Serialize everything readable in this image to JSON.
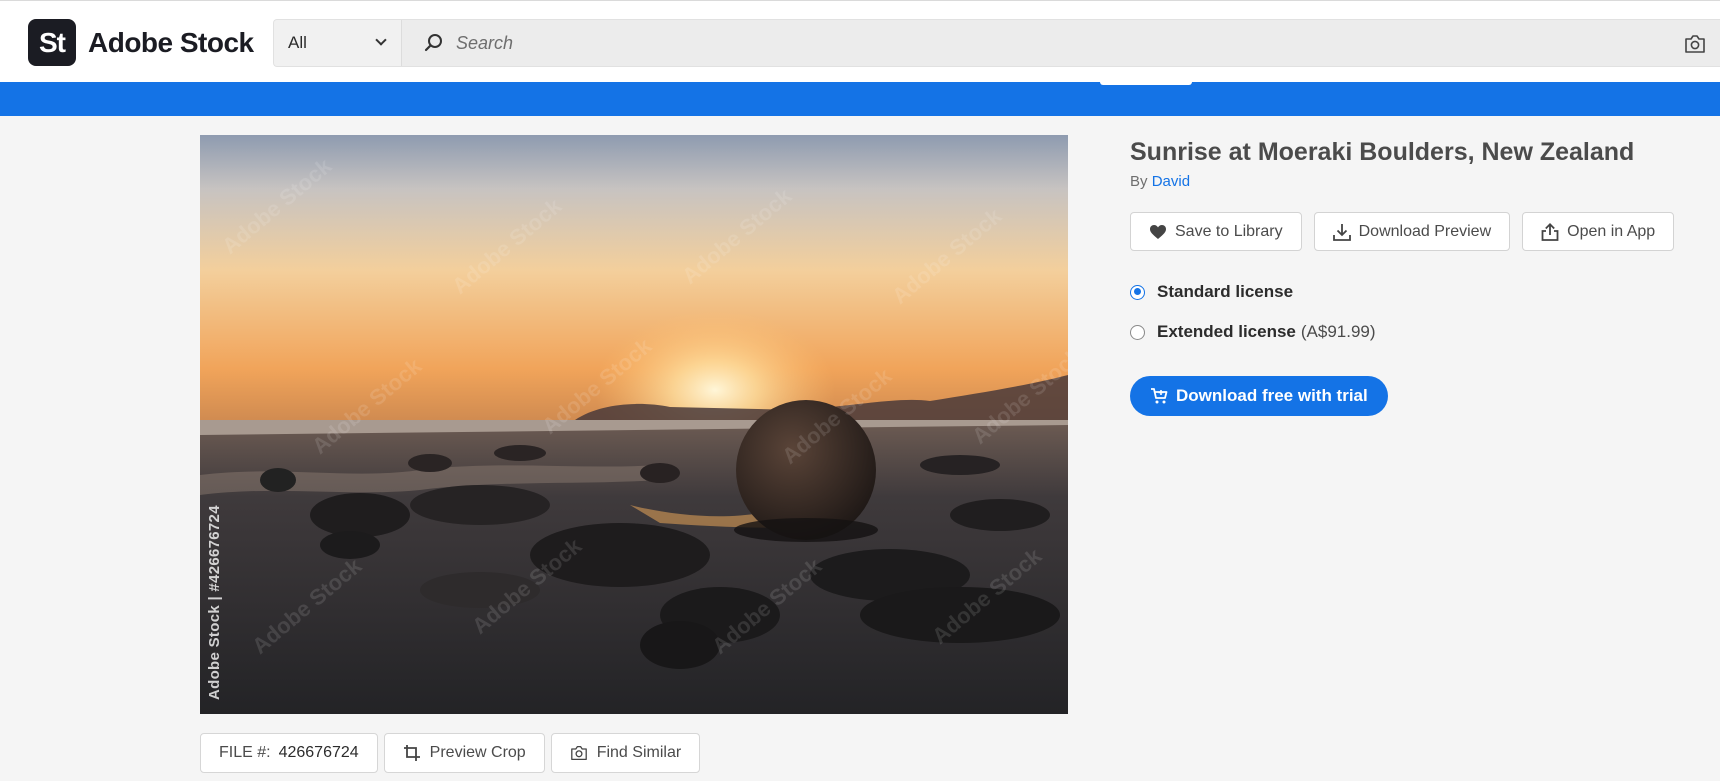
{
  "brand": {
    "badge": "St",
    "name": "Adobe Stock"
  },
  "search": {
    "scope": "All",
    "placeholder": "Search"
  },
  "icons": {
    "search": "magnifier-icon",
    "camera": "camera-icon",
    "heart": "heart-icon",
    "download": "download-icon",
    "share": "share-icon",
    "cart": "cart-icon",
    "crop": "crop-icon",
    "chevron": "chevron-down-icon"
  },
  "asset": {
    "title": "Sunrise at Moeraki Boulders, New Zealand",
    "by_label": "By",
    "author": "David",
    "side_watermark": "Adobe Stock | #426676724",
    "watermark_text": "Adobe Stock"
  },
  "actions": {
    "save": "Save to Library",
    "download_preview": "Download Preview",
    "open_in_app": "Open in App"
  },
  "licenses": [
    {
      "name": "Standard license",
      "price": "",
      "selected": true
    },
    {
      "name": "Extended license",
      "price": "(A$91.99)",
      "selected": false
    }
  ],
  "cta": {
    "label": "Download free with trial"
  },
  "file": {
    "label": "FILE #:",
    "number": "426676724"
  },
  "tools": {
    "preview_crop": "Preview Crop",
    "find_similar": "Find Similar"
  },
  "colors": {
    "accent": "#1473e6",
    "brand_dark": "#1b1c23",
    "background": "#f5f5f5"
  }
}
